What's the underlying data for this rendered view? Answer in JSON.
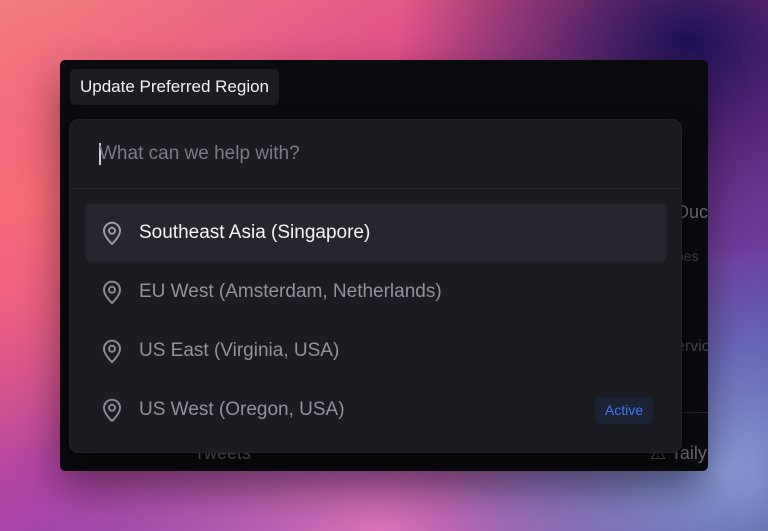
{
  "header": {
    "title": "Update Preferred Region"
  },
  "search": {
    "placeholder": "What can we help with?",
    "value": ""
  },
  "regions": [
    {
      "label": "Southeast Asia (Singapore)",
      "icon": "map-pin-icon",
      "selected": true
    },
    {
      "label": "EU West (Amsterdam, Netherlands)",
      "icon": "map-pin-icon"
    },
    {
      "label": "US East (Virginia, USA)",
      "icon": "map-pin-icon"
    },
    {
      "label": "US West (Oregon, USA)",
      "icon": "map-pin-icon",
      "badge": "Active"
    }
  ],
  "background_app": {
    "title_fragment": "Duc",
    "line1_fragment": "hes",
    "line2_fragment": "ervic",
    "tweets_label": "Tweets",
    "tail_fragment": "⚠ Taily"
  },
  "colors": {
    "badge_text": "#3d7cf0",
    "badge_bg": "#1a2233",
    "selected_row": "#26262e",
    "palette_bg": "#1b1b22"
  }
}
